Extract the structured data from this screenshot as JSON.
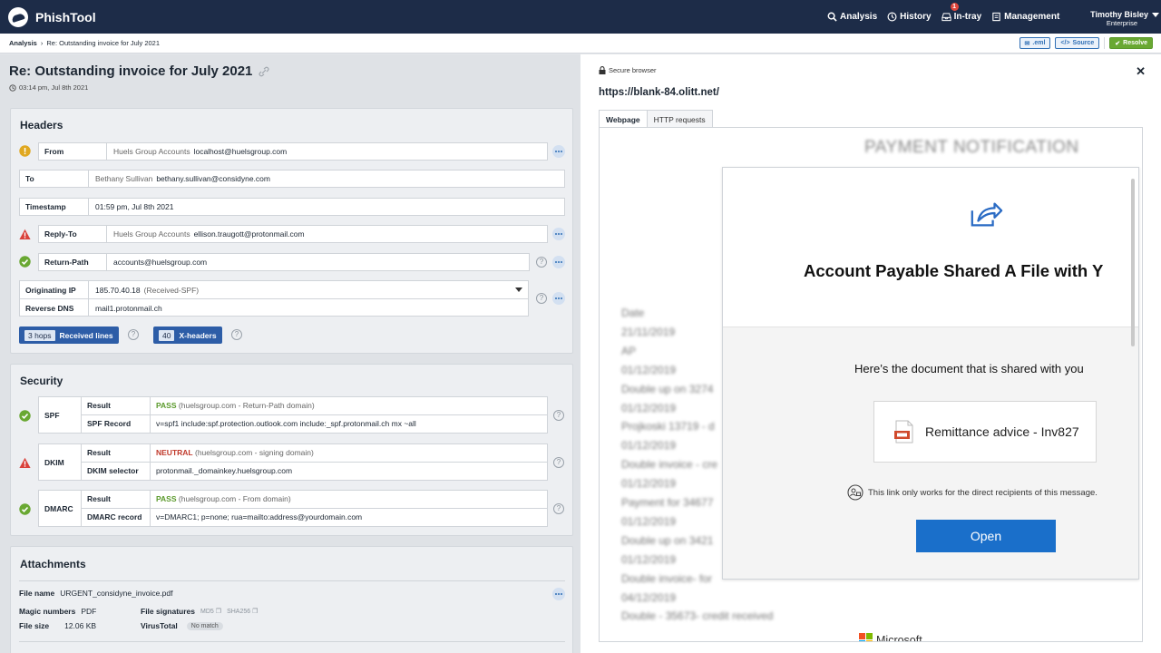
{
  "app": {
    "name": "PhishTool"
  },
  "nav": {
    "analysis": "Analysis",
    "history": "History",
    "intray": "In-tray",
    "intray_badge": "1",
    "management": "Management"
  },
  "user": {
    "name": "Timothy Bisley",
    "plan": "Enterprise"
  },
  "breadcrumb": {
    "root": "Analysis",
    "current": "Re: Outstanding invoice for July 2021"
  },
  "actions": {
    "eml": ".eml",
    "source": "Source",
    "resolve": "Resolve"
  },
  "message": {
    "subject": "Re: Outstanding invoice for July 2021",
    "date": "03:14 pm, Jul 8th 2021"
  },
  "headers": {
    "title": "Headers",
    "from": {
      "label": "From",
      "name": "Huels Group Accounts",
      "email": "localhost@huelsgroup.com"
    },
    "to": {
      "label": "To",
      "name": "Bethany Sullivan",
      "email": "bethany.sullivan@considyne.com"
    },
    "timestamp": {
      "label": "Timestamp",
      "value": "01:59 pm, Jul 8th 2021"
    },
    "reply_to": {
      "label": "Reply-To",
      "name": "Huels Group Accounts",
      "email": "ellison.traugott@protonmail.com"
    },
    "return_path": {
      "label": "Return-Path",
      "value": "accounts@huelsgroup.com"
    },
    "originating_ip": {
      "label": "Originating IP",
      "value": "185.70.40.18",
      "note": "(Received-SPF)"
    },
    "reverse_dns": {
      "label": "Reverse DNS",
      "value": "mail1.protonmail.ch"
    },
    "hops": {
      "count": "3 hops",
      "label": "Received lines"
    },
    "xheaders": {
      "count": "40",
      "label": "X-headers"
    }
  },
  "security": {
    "title": "Security",
    "spf": {
      "name": "SPF",
      "result_label": "Result",
      "result": "PASS",
      "result_note": "(huelsgroup.com - Return-Path domain)",
      "record_label": "SPF Record",
      "record": "v=spf1 include:spf.protection.outlook.com include:_spf.protonmail.ch mx ~all"
    },
    "dkim": {
      "name": "DKIM",
      "result_label": "Result",
      "result": "NEUTRAL",
      "result_note": "(huelsgroup.com - signing domain)",
      "selector_label": "DKIM selector",
      "selector": "protonmail._domainkey.huelsgroup.com"
    },
    "dmarc": {
      "name": "DMARC",
      "result_label": "Result",
      "result": "PASS",
      "result_note": "(huelsgroup.com - From domain)",
      "record_label": "DMARC record",
      "record": "v=DMARC1; p=none; rua=mailto:address@yourdomain.com"
    }
  },
  "attachments": {
    "title": "Attachments",
    "file_name_label": "File name",
    "file_name": "URGENT_considyne_invoice.pdf",
    "magic_label": "Magic numbers",
    "magic": "PDF",
    "size_label": "File size",
    "size": "12.06 KB",
    "sig_label": "File signatures",
    "md5": "MD5",
    "sha256": "SHA256",
    "vt_label": "VirusTotal",
    "vt": "No match"
  },
  "browser": {
    "secure": "Secure browser",
    "url": "https://blank-84.olitt.net/",
    "tabs": [
      "Webpage",
      "HTTP requests"
    ],
    "bg_title": "PAYMENT NOTIFICATION",
    "bg_rows": [
      "Date",
      "21/11/2019",
      "AP",
      "01/12/2019",
      "Double up on 3274",
      "01/12/2019",
      "Projkoski 13719 - d",
      "01/12/2019",
      "Double invoice - cre",
      "01/12/2019",
      "Payment for 34677",
      "01/12/2019",
      "Double up on 3421",
      "01/12/2019",
      "Double invoice- for",
      "04/12/2019",
      "Double - 35673- credit received"
    ],
    "modal_heading": "Account Payable Shared A File with Y",
    "doc_title": "Here’s the document that is shared with you",
    "doc_name": "Remittance advice - Inv827",
    "link_note": "This link only works for the direct recipients of this message.",
    "open_label": "Open",
    "microsoft": "Microsoft"
  }
}
